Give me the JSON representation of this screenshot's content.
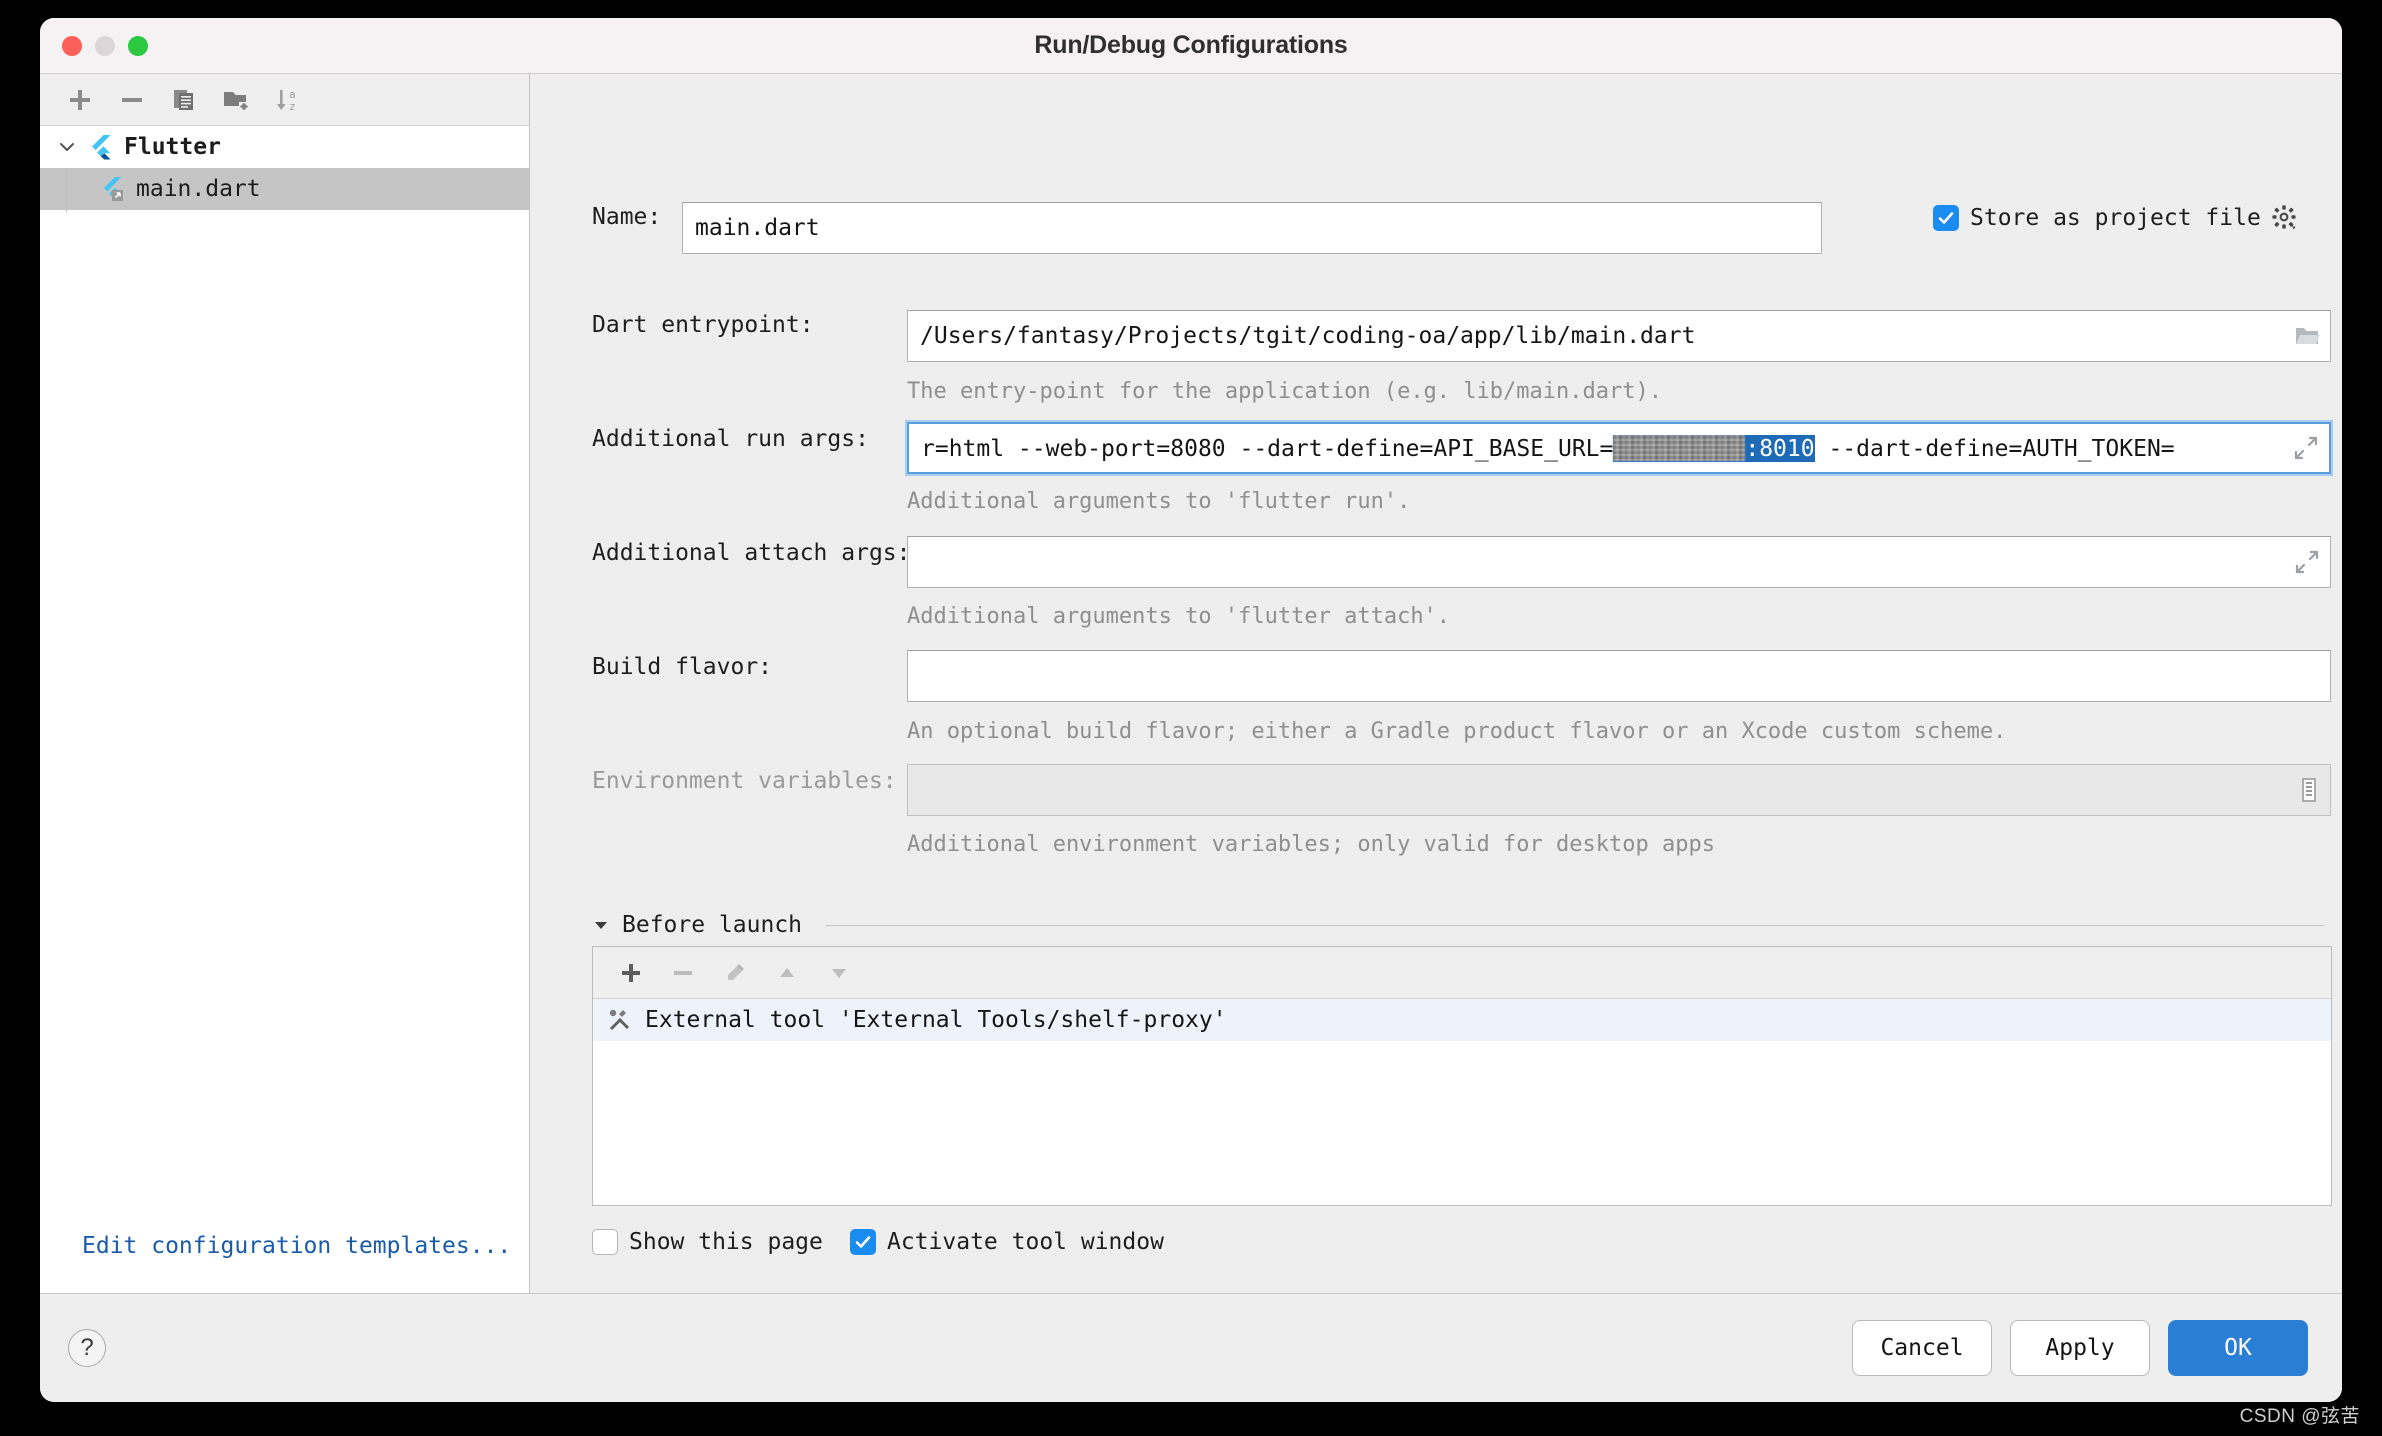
{
  "window": {
    "title": "Run/Debug Configurations"
  },
  "titlebar_buttons": {
    "close": "close-button",
    "minimize": "minimize-button",
    "zoom": "zoom-button"
  },
  "left_toolbar": {
    "items": [
      {
        "name": "add-configuration-button",
        "icon": "plus-icon",
        "tooltip": "Add New Configuration"
      },
      {
        "name": "remove-configuration-button",
        "icon": "minus-icon",
        "tooltip": "Remove Configuration"
      },
      {
        "name": "copy-configuration-button",
        "icon": "copy-icon",
        "tooltip": "Copy Configuration"
      },
      {
        "name": "save-configuration-button",
        "icon": "folder-add-icon",
        "tooltip": "Save Configuration"
      },
      {
        "name": "sort-configurations-button",
        "icon": "sort-alpha-icon",
        "tooltip": "Sort Configurations"
      }
    ]
  },
  "tree": {
    "group": {
      "label": "Flutter",
      "icon": "flutter-icon",
      "expanded": true
    },
    "children": [
      {
        "label": "main.dart",
        "icon": "flutter-dart-icon",
        "selected": true
      }
    ]
  },
  "edit_templates_link": "Edit configuration templates...",
  "form": {
    "name": {
      "label": "Name:",
      "value": "main.dart",
      "placeholder": ""
    },
    "store_as_project_file": {
      "label": "Store as project file",
      "checked": true,
      "gear_icon": "gear-icon"
    },
    "dart_entrypoint": {
      "label": "Dart entrypoint:",
      "value": "/Users/fantasy/Projects/tgit/coding-oa/app/lib/main.dart",
      "browse_icon": "folder-browse-icon",
      "hint": "The entry-point for the application (e.g. lib/main.dart)."
    },
    "additional_run_args": {
      "label": "Additional run args:",
      "value_prefix": "r=html --web-port=8080 --dart-define=API_BASE_URL=",
      "value_selected_redacted": "██████████",
      "value_selected_visible": ":8010",
      "value_suffix": " --dart-define=AUTH_TOKEN=",
      "expand_icon": "expand-icon",
      "hint": "Additional arguments to 'flutter run'.",
      "focused": true
    },
    "additional_attach_args": {
      "label": "Additional attach args:",
      "value": "",
      "expand_icon": "expand-icon",
      "hint": "Additional arguments to 'flutter attach'."
    },
    "build_flavor": {
      "label": "Build flavor:",
      "value": "",
      "hint": "An optional build flavor; either a Gradle product flavor or an Xcode custom scheme."
    },
    "environment_variables": {
      "label": "Environment variables:",
      "value": "",
      "disabled": true,
      "browse_icon": "env-list-icon",
      "hint": "Additional environment variables; only valid for desktop apps"
    }
  },
  "before_launch": {
    "title": "Before launch",
    "collapse_icon": "triangle-down-icon",
    "toolbar": [
      {
        "name": "add-task-button",
        "icon": "plus-icon",
        "enabled": true
      },
      {
        "name": "remove-task-button",
        "icon": "minus-icon",
        "enabled": false
      },
      {
        "name": "edit-task-button",
        "icon": "pencil-icon",
        "enabled": false
      },
      {
        "name": "move-up-button",
        "icon": "arrow-up-icon",
        "enabled": false
      },
      {
        "name": "move-down-button",
        "icon": "arrow-down-icon",
        "enabled": false
      }
    ],
    "items": [
      {
        "label": "External tool 'External Tools/shelf-proxy'",
        "icon": "hammer-wrench-icon",
        "selected": true
      }
    ],
    "options": {
      "show_this_page": {
        "label": "Show this page",
        "checked": false
      },
      "activate_tool_window": {
        "label": "Activate tool window",
        "checked": true
      }
    }
  },
  "footer": {
    "help_label": "?",
    "cancel_label": "Cancel",
    "apply_label": "Apply",
    "ok_label": "OK"
  },
  "watermark": "CSDN @弦苦",
  "colors": {
    "accent_blue": "#2a7fd4",
    "checkbox_blue": "#1a8cf0",
    "selection_blue": "#1f6bb8",
    "link_blue": "#1a5ba8",
    "window_bg": "#eeeeee",
    "titlebar_bg": "#f6f1f3"
  }
}
